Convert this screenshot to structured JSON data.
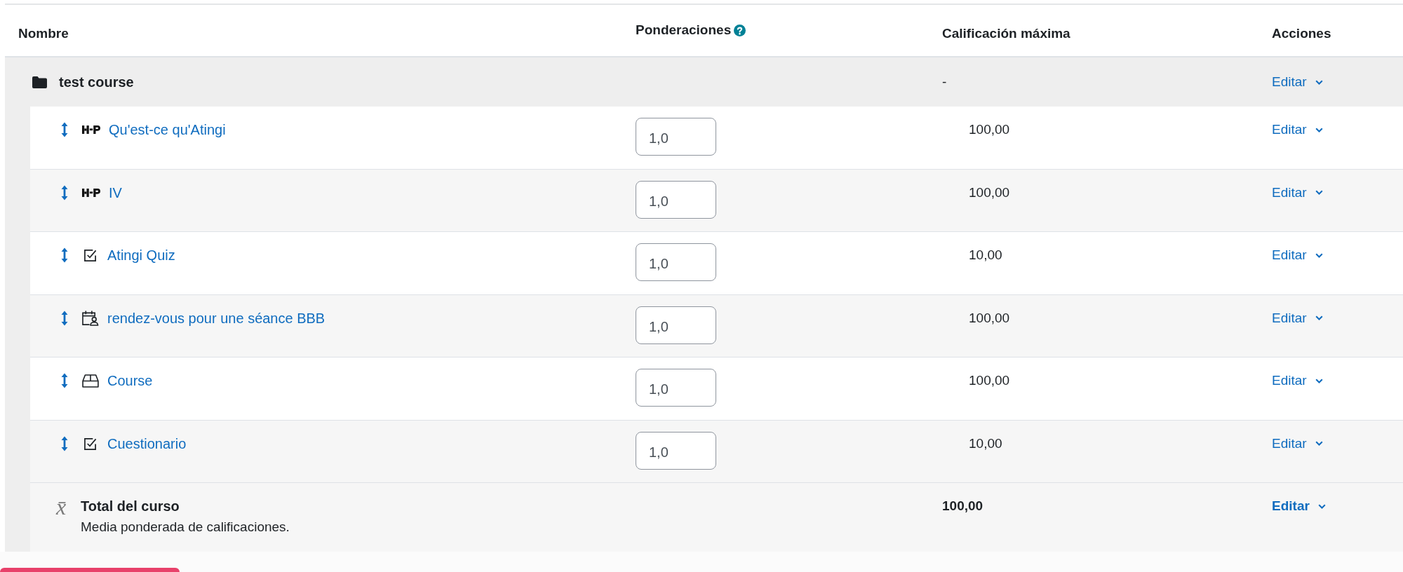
{
  "table": {
    "columns": [
      {
        "label": "Nombre",
        "help": false
      },
      {
        "label": "Ponderaciones",
        "help": true
      },
      {
        "label": "Calificación máxima",
        "help": false
      },
      {
        "label": "Acciones",
        "help": false
      }
    ]
  },
  "category": {
    "name": "test course",
    "max_grade": "-",
    "action": "Editar"
  },
  "items": [
    {
      "kind": "h5p",
      "name": "Qu'est-ce qu'Atingi",
      "weight": "1,0",
      "max_grade": "100,00",
      "action": "Editar"
    },
    {
      "kind": "h5p",
      "name": "IV",
      "weight": "1,0",
      "max_grade": "100,00",
      "action": "Editar"
    },
    {
      "kind": "quiz",
      "name": "Atingi Quiz",
      "weight": "1,0",
      "max_grade": "10,00",
      "action": "Editar"
    },
    {
      "kind": "scheduler",
      "name": "rendez-vous pour une séance BBB",
      "weight": "1,0",
      "max_grade": "100,00",
      "action": "Editar"
    },
    {
      "kind": "course",
      "name": "Course",
      "weight": "1,0",
      "max_grade": "100,00",
      "action": "Editar"
    },
    {
      "kind": "quiz",
      "name": "Cuestionario",
      "weight": "1,0",
      "max_grade": "10,00",
      "action": "Editar"
    }
  ],
  "total": {
    "symbol": "x̄",
    "name": "Total del curso",
    "description": "Media ponderada de calificaciones.",
    "max_grade": "100,00",
    "action": "Editar"
  }
}
